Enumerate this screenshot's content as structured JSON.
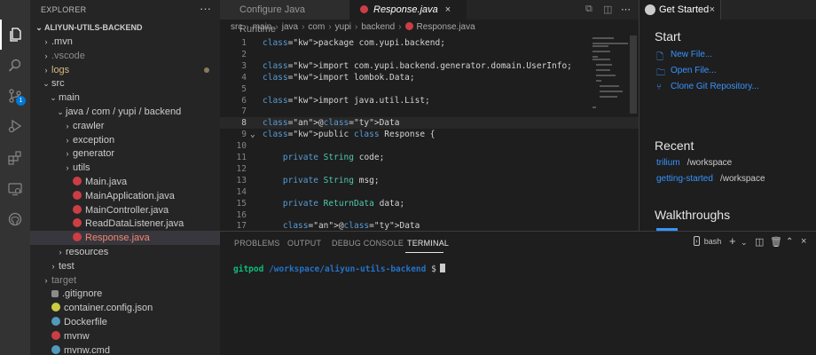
{
  "activity_bar": {
    "icons": [
      "explorer-icon",
      "search-icon",
      "source-control-icon",
      "run-debug-icon",
      "extensions-icon",
      "remote-explorer-icon",
      "github-icon"
    ],
    "source_control_badge": "1"
  },
  "sidebar": {
    "title": "EXPLORER",
    "more": "···",
    "root": "ALIYUN-UTILS-BACKEND",
    "tree": [
      {
        "label": ".mvn",
        "depth": 1,
        "chevron": "›",
        "style": ""
      },
      {
        "label": ".vscode",
        "depth": 1,
        "chevron": "›",
        "style": "dim"
      },
      {
        "label": "logs",
        "depth": 1,
        "chevron": "›",
        "style": "mod"
      },
      {
        "label": "src",
        "depth": 1,
        "chevron": "⌄",
        "style": ""
      },
      {
        "label": "main",
        "depth": 2,
        "chevron": "⌄",
        "style": ""
      },
      {
        "label": "java / com / yupi / backend",
        "depth": 3,
        "chevron": "⌄",
        "style": ""
      },
      {
        "label": "crawler",
        "depth": 4,
        "chevron": "›",
        "style": ""
      },
      {
        "label": "exception",
        "depth": 4,
        "chevron": "›",
        "style": ""
      },
      {
        "label": "generator",
        "depth": 4,
        "chevron": "›",
        "style": ""
      },
      {
        "label": "utils",
        "depth": 4,
        "chevron": "›",
        "style": ""
      },
      {
        "label": "Main.java",
        "depth": 4,
        "chevron": "",
        "style": "",
        "icon": "java"
      },
      {
        "label": "MainApplication.java",
        "depth": 4,
        "chevron": "",
        "style": "",
        "icon": "java"
      },
      {
        "label": "MainController.java",
        "depth": 4,
        "chevron": "",
        "style": "",
        "icon": "java"
      },
      {
        "label": "ReadDataListener.java",
        "depth": 4,
        "chevron": "",
        "style": "",
        "icon": "java"
      },
      {
        "label": "Response.java",
        "depth": 4,
        "chevron": "",
        "style": "err",
        "icon": "java",
        "selected": true
      },
      {
        "label": "resources",
        "depth": 3,
        "chevron": "›",
        "style": ""
      },
      {
        "label": "test",
        "depth": 2,
        "chevron": "›",
        "style": ""
      },
      {
        "label": "target",
        "depth": 1,
        "chevron": "›",
        "style": "dim"
      },
      {
        "label": ".gitignore",
        "depth": 1,
        "chevron": "",
        "style": "",
        "icon": "git"
      },
      {
        "label": "container.config.json",
        "depth": 1,
        "chevron": "",
        "style": "",
        "icon": "json"
      },
      {
        "label": "Dockerfile",
        "depth": 1,
        "chevron": "",
        "style": "",
        "icon": "docker"
      },
      {
        "label": "mvnw",
        "depth": 1,
        "chevron": "",
        "style": "",
        "icon": "mvn"
      },
      {
        "label": "mvnw.cmd",
        "depth": 1,
        "chevron": "",
        "style": "",
        "icon": "win"
      }
    ]
  },
  "tabs": [
    {
      "label": "Configure Java Runtime",
      "active": false
    },
    {
      "label": "Response.java",
      "active": true,
      "close": "×"
    }
  ],
  "breadcrumb": [
    "src",
    "main",
    "java",
    "com",
    "yupi",
    "backend",
    "Response.java"
  ],
  "code": [
    {
      "n": "1",
      "text": "package com.yupi.backend;"
    },
    {
      "n": "2",
      "text": ""
    },
    {
      "n": "3",
      "text": "import com.yupi.backend.generator.domain.UserInfo;"
    },
    {
      "n": "4",
      "text": "import lombok.Data;"
    },
    {
      "n": "5",
      "text": ""
    },
    {
      "n": "6",
      "text": "import java.util.List;"
    },
    {
      "n": "7",
      "text": ""
    },
    {
      "n": "8",
      "text": "@Data"
    },
    {
      "n": "9",
      "text": "public class Response {"
    },
    {
      "n": "10",
      "text": ""
    },
    {
      "n": "11",
      "text": "    private String code;"
    },
    {
      "n": "12",
      "text": ""
    },
    {
      "n": "13",
      "text": "    private String msg;"
    },
    {
      "n": "14",
      "text": ""
    },
    {
      "n": "15",
      "text": "    private ReturnData data;"
    },
    {
      "n": "16",
      "text": ""
    },
    {
      "n": "17",
      "text": "    @Data"
    }
  ],
  "right_panel": {
    "tab_label": "Get Started",
    "start_heading": "Start",
    "start_links": [
      "New File...",
      "Open File...",
      "Clone Git Repository..."
    ],
    "recent_heading": "Recent",
    "recent": [
      {
        "name": "trilium",
        "path": "/workspace"
      },
      {
        "name": "getting-started",
        "path": "/workspace"
      }
    ],
    "walkthroughs_heading": "Walkthroughs"
  },
  "panel": {
    "tabs": [
      "PROBLEMS",
      "OUTPUT",
      "DEBUG CONSOLE",
      "TERMINAL"
    ],
    "active_tab": "TERMINAL",
    "shell_label": "bash",
    "terminal": {
      "user": "gitpod",
      "path": "/workspace/aliyun-utils-backend",
      "prompt": "$"
    }
  }
}
